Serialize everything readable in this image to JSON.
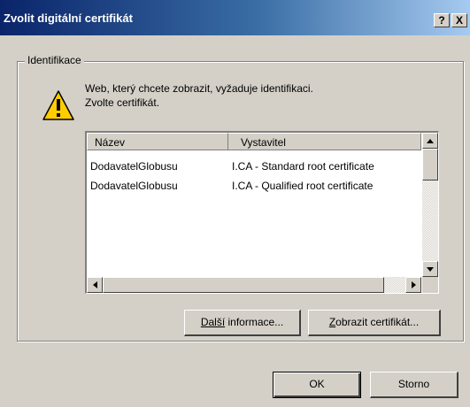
{
  "window": {
    "title": "Zvolit digitální certifikát",
    "help_button": "?",
    "close_button": "X"
  },
  "group": {
    "label": "Identifikace"
  },
  "message": {
    "line1": "Web, který chcete zobrazit, vyžaduje identifikaci.",
    "line2": "Zvolte certifikát.",
    "icon": "warning-icon"
  },
  "list": {
    "columns": [
      "Název",
      "Vystavitel"
    ],
    "rows": [
      {
        "name": "DodavatelGlobusu",
        "issuer": "I.CA - Standard root certificate"
      },
      {
        "name": "DodavatelGlobusu",
        "issuer": "I.CA - Qualified root certificate"
      }
    ]
  },
  "buttons": {
    "more_info_prefix": "Další",
    "more_info_suffix": " informace...",
    "view_cert_prefix": "Z",
    "view_cert_suffix": "obrazit certifikát...",
    "ok": "OK",
    "cancel": "Storno"
  },
  "colors": {
    "dialog_bg": "#d4d0c8",
    "title_start": "#0a246a",
    "title_end": "#a6caf0"
  }
}
